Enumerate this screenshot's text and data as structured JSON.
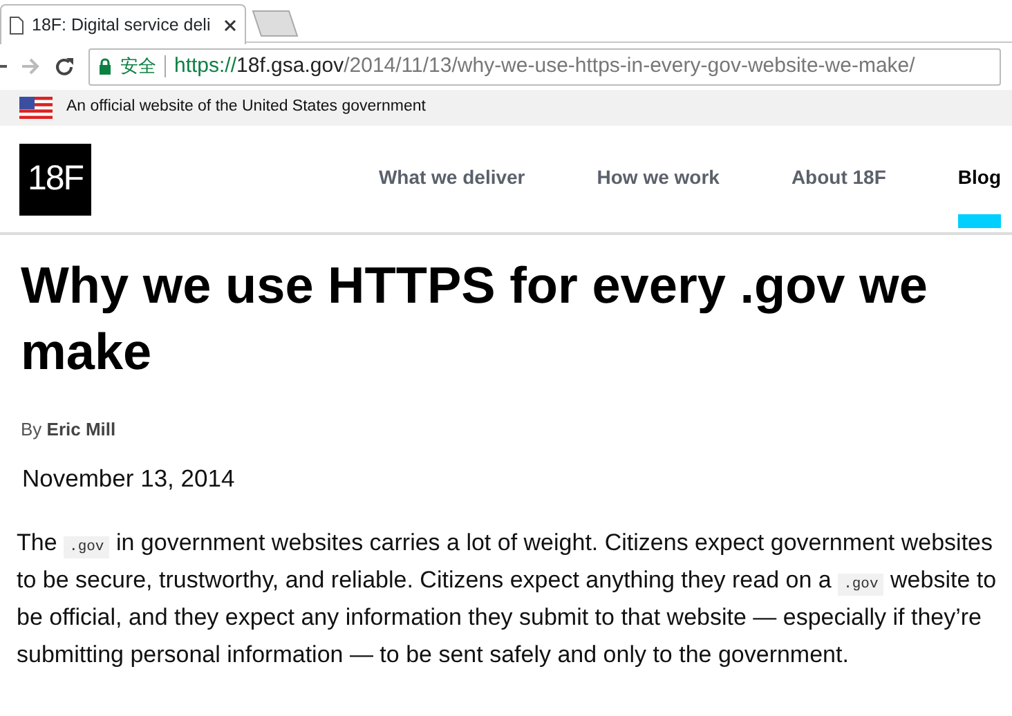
{
  "browser": {
    "tab": {
      "title": "18F: Digital service deli",
      "selected": true
    },
    "security_label": "安全",
    "url": {
      "scheme": "https://",
      "host": "18f.gsa.gov",
      "path": "/2014/11/13/why-we-use-https-in-every-gov-website-we-make/"
    }
  },
  "gov_banner": {
    "text": "An official website of the United States government"
  },
  "header": {
    "logo": "18F",
    "nav": [
      {
        "label": "What we deliver",
        "selected": false
      },
      {
        "label": "How we work",
        "selected": false
      },
      {
        "label": "About 18F",
        "selected": false
      },
      {
        "label": "Blog",
        "selected": true
      }
    ]
  },
  "article": {
    "title": "Why we use HTTPS for every .gov we make",
    "byline_prefix": "By",
    "author": "Eric Mill",
    "date": "November 13, 2014",
    "paragraph": [
      {
        "kind": "text",
        "text": "The "
      },
      {
        "kind": "code",
        "text": ".gov"
      },
      {
        "kind": "text",
        "text": " in government websites carries a lot of weight. Citizens expect government websites to be secure, trustworthy, and reliable. Citizens expect anything they read on a "
      },
      {
        "kind": "code",
        "text": ".gov"
      },
      {
        "kind": "text",
        "text": " website to be official, and they expect any information they submit to that website — especially if they’re submitting personal information — to be sent safely and only to the government."
      }
    ]
  }
}
